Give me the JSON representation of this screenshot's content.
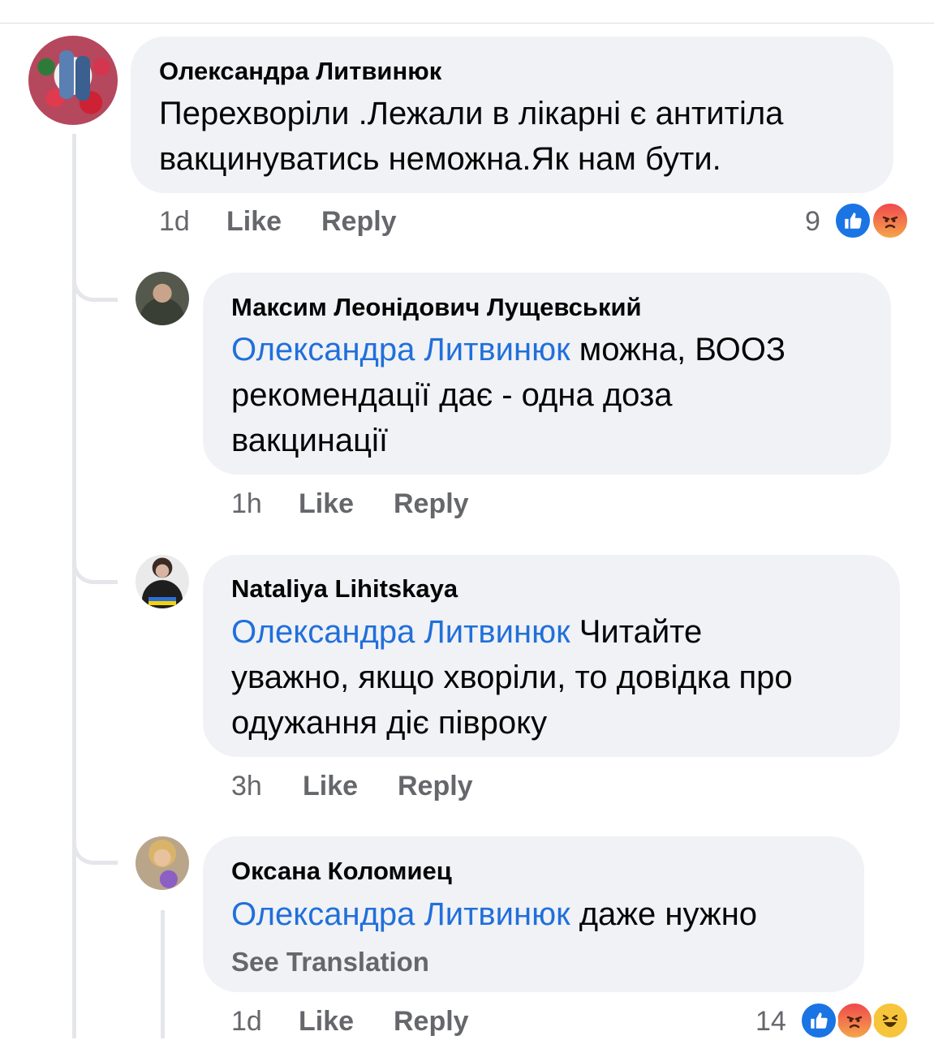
{
  "comments": [
    {
      "author": "Олександра Литвинюк",
      "text": "Перехворіли .Лежали в лікарні є антитіла вакцинуватись неможна.Як нам  бути.",
      "line1": "Перехворіли .Лежали в лікарні є антитіла",
      "line2": "вакцинуватись неможна.Як нам  бути.",
      "time": "1d",
      "like": "Like",
      "reply": "Reply",
      "reaction_count": "9",
      "reactions": [
        "like-icon",
        "angry-icon"
      ]
    }
  ],
  "replies": [
    {
      "author": "Максим Леонідович Лущевський",
      "mention": "Олександра Литвинюк",
      "line1_rest": " можна, ВООЗ",
      "line2": "рекомендації дає - одна доза",
      "line3": "вакцинації",
      "time": "1h",
      "like": "Like",
      "reply": "Reply"
    },
    {
      "author": "Nataliya Lihitskaya",
      "mention": "Олександра Литвинюк",
      "line1_rest": " Читайте",
      "line2": "уважно, якщо хворіли, то довідка про",
      "line3": "одужання діє півроку",
      "time": "3h",
      "like": "Like",
      "reply": "Reply"
    },
    {
      "author": "Оксана Коломиец",
      "mention": "Олександра Литвинюк",
      "line1_rest": " даже нужно",
      "see_translation": "See Translation",
      "time": "1d",
      "like": "Like",
      "reply": "Reply",
      "reaction_count": "14",
      "reactions": [
        "like-icon",
        "angry-icon",
        "haha-icon"
      ]
    }
  ],
  "colors": {
    "mention": "#216fdb",
    "bubble": "#f0f2f5",
    "meta": "#65676b",
    "like_reaction": "#1b74e4"
  }
}
